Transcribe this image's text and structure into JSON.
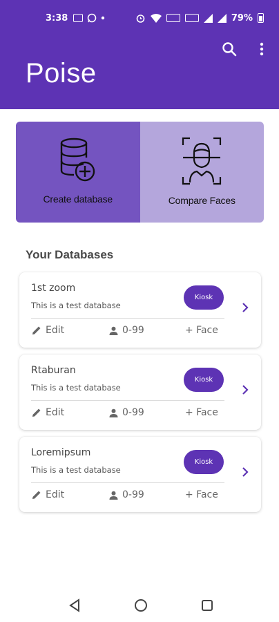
{
  "status_bar": {
    "time": "3:38",
    "battery": "79%"
  },
  "app_bar": {
    "title": "Poise",
    "icons": [
      "search-icon",
      "more-vert-icon"
    ]
  },
  "actions": [
    {
      "label": "Create database",
      "icon": "database-add-icon",
      "bg": "#7454c0"
    },
    {
      "label": "Compare Faces",
      "icon": "face-scan-icon",
      "bg": "#b4a6dc"
    }
  ],
  "section": {
    "title": "Your Databases"
  },
  "databases": [
    {
      "name": "1st zoom",
      "description": "This is a test database",
      "badge": "Kiosk",
      "edit_label": "Edit",
      "range_label": "0-99",
      "face_label": "+ Face"
    },
    {
      "name": "Rtaburan",
      "description": "This is a test database",
      "badge": "Kiosk",
      "edit_label": "Edit",
      "range_label": "0-99",
      "face_label": "+ Face"
    },
    {
      "name": "Loremipsum",
      "description": "This is a test database",
      "badge": "Kiosk",
      "edit_label": "Edit",
      "range_label": "0-99",
      "face_label": "+ Face"
    }
  ],
  "colors": {
    "primary": "#5d33b4",
    "tile_dark": "#7454c0",
    "tile_light": "#b4a6dc"
  }
}
